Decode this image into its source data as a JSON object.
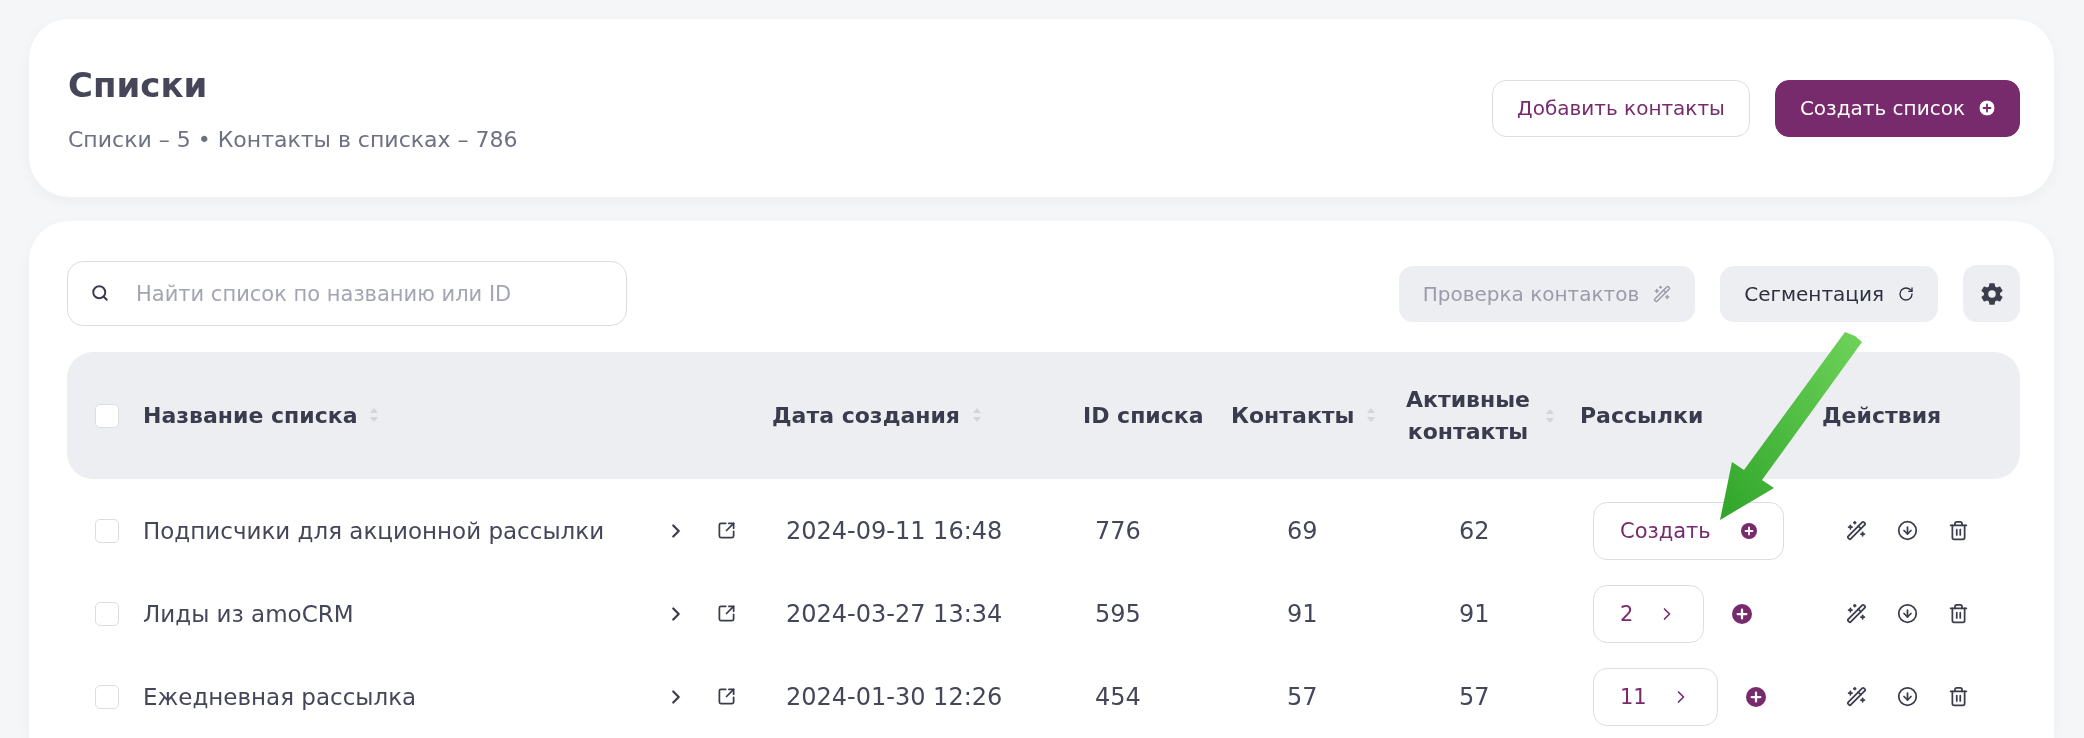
{
  "header": {
    "title": "Списки",
    "summary": "Списки – 5 • Контакты в списках – 786",
    "buttons": [
      {
        "label": "Добавить контакты",
        "kind": "secondary"
      },
      {
        "label": "Создать список",
        "kind": "primary"
      }
    ]
  },
  "toolbar": {
    "search": {
      "placeholder": "Найти список по названию или ID"
    },
    "buttons": [
      {
        "label": "Проверка контактов",
        "kind": "check",
        "disabled": true
      },
      {
        "label": "Сегментация",
        "kind": "segment",
        "disabled": false
      }
    ]
  },
  "table": {
    "select_all": {
      "checked": false
    },
    "columns": [
      {
        "label": "Название списка",
        "sortable": true
      },
      {
        "label": "Дата создания",
        "sortable": true
      },
      {
        "label": "ID списка",
        "sortable": false
      },
      {
        "label": "Контакты",
        "sortable": true
      },
      {
        "label": "Активные контакты",
        "sortable": true
      },
      {
        "label": "Рассылки",
        "sortable": false
      },
      {
        "label": "Действия",
        "sortable": false
      }
    ],
    "rows": [
      {
        "checked": false,
        "name": "Подписчики для акционной рассылки",
        "date": "2024-09-11 16:48",
        "id": "776",
        "contacts": "69",
        "active": "62",
        "mailings": {
          "kind": "create",
          "label": "Создать"
        }
      },
      {
        "checked": false,
        "name": "Лиды из amoCRM",
        "date": "2024-03-27 13:34",
        "id": "595",
        "contacts": "91",
        "active": "91",
        "mailings": {
          "kind": "count",
          "label": "2"
        }
      },
      {
        "checked": false,
        "name": "Ежедневная рассылка",
        "date": "2024-01-30 12:26",
        "id": "454",
        "contacts": "57",
        "active": "57",
        "mailings": {
          "kind": "count",
          "label": "11"
        }
      }
    ]
  }
}
